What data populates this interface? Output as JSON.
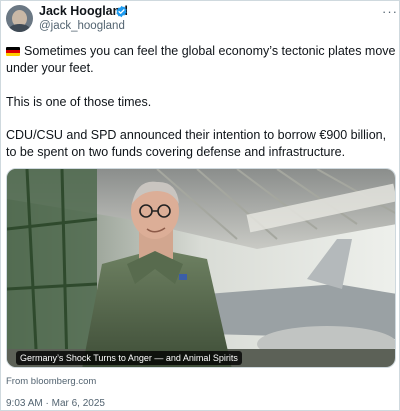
{
  "author": {
    "name": "Jack Hoogland",
    "handle": "@jack_hoogland",
    "verified": true,
    "avatar_icon": "user-avatar"
  },
  "more_menu": {
    "label": "···",
    "icon": "more-icon"
  },
  "post": {
    "flag_icon": "germany-flag-icon",
    "paragraphs": [
      "Sometimes you can feel the global economy’s tectonic plates move under your feet.",
      "This is one of those times.",
      "CDU/CSU and SPD announced their intention  to borrow €900 billion, to be spent on two funds covering defense and  infrastructure."
    ]
  },
  "link_card": {
    "caption": "Germany’s Shock Turns to Anger — and Animal Spirits",
    "source": "From bloomberg.com"
  },
  "timestamp": {
    "time": "9:03 AM",
    "separator": "·",
    "date": "Mar 6, 2025"
  },
  "colors": {
    "text": "#0f1419",
    "secondary": "#536471",
    "verified": "#1d9bf0",
    "border": "#cfd9de"
  }
}
